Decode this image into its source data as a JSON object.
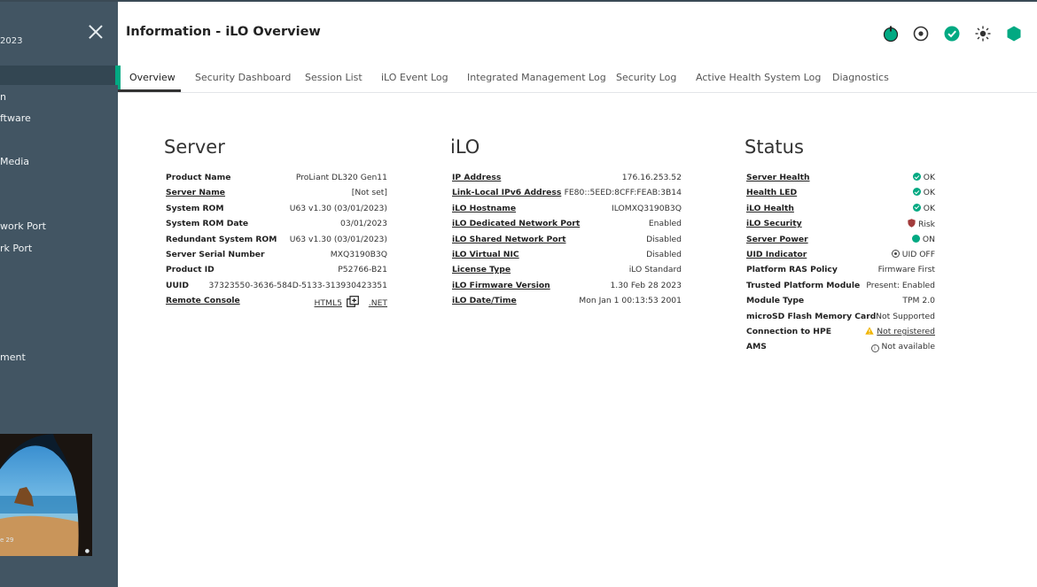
{
  "sidebar": {
    "date_fragment": "2023",
    "items": [
      {
        "label": "n",
        "top": 0
      },
      {
        "label": "ftware"
      },
      {
        "label": "Media"
      },
      {
        "label": "work Port"
      },
      {
        "label": "rk Port"
      },
      {
        "label": "ment"
      }
    ],
    "thumbnail_text": "e 29",
    "thumbnail_dot": "●"
  },
  "header": {
    "title": "Information - iLO Overview"
  },
  "colors": {
    "accent": "#01a982",
    "sidebar": "#425563",
    "risk": "#a23b3b",
    "warning": "#f0b400"
  },
  "top_icons": [
    "power-icon",
    "uid-icon",
    "health-ok-icon",
    "brightness-icon",
    "security-hexagon-icon"
  ],
  "tabs": [
    {
      "label": "Overview"
    },
    {
      "label": "Security Dashboard"
    },
    {
      "label": "Session List"
    },
    {
      "label": "iLO Event Log"
    },
    {
      "label": "Integrated Management Log"
    },
    {
      "label": "Security Log"
    },
    {
      "label": "Active Health System Log"
    },
    {
      "label": "Diagnostics"
    }
  ],
  "server": {
    "title": "Server",
    "rows": [
      {
        "label": "Product Name",
        "value": "ProLiant DL320 Gen11"
      },
      {
        "label": "Server Name",
        "value": "[Not set]"
      },
      {
        "label": "System ROM",
        "value": "U63 v1.30 (03/01/2023)"
      },
      {
        "label": "System ROM Date",
        "value": "03/01/2023"
      },
      {
        "label": "Redundant System ROM",
        "value": "U63 v1.30 (03/01/2023)"
      },
      {
        "label": "Server Serial Number",
        "value": "MXQ3190B3Q"
      },
      {
        "label": "Product ID",
        "value": "P52766-B21"
      },
      {
        "label": "UUID",
        "value": "37323550-3636-584D-5133-313930423351"
      }
    ],
    "remote_console": {
      "label": "Remote Console",
      "html5": "HTML5",
      "net": ".NET"
    }
  },
  "ilo": {
    "title": "iLO",
    "rows": [
      {
        "label": "IP Address",
        "value": "176.16.253.52"
      },
      {
        "label": "Link-Local IPv6 Address",
        "value": "FE80::5EED:8CFF:FEAB:3B14"
      },
      {
        "label": "iLO Hostname",
        "value": "ILOMXQ3190B3Q"
      },
      {
        "label": "iLO Dedicated Network Port",
        "value": "Enabled"
      },
      {
        "label": "iLO Shared Network Port",
        "value": "Disabled"
      },
      {
        "label": "iLO Virtual NIC",
        "value": "Disabled"
      },
      {
        "label": "License Type",
        "value": "iLO Standard"
      },
      {
        "label": "iLO Firmware Version",
        "value": "1.30 Feb 28 2023"
      },
      {
        "label": "iLO Date/Time",
        "value": "Mon Jan 1 00:13:53 2001"
      }
    ]
  },
  "status": {
    "title": "Status",
    "rows": [
      {
        "label": "Server Health",
        "value": "OK"
      },
      {
        "label": "Health LED",
        "value": "OK"
      },
      {
        "label": "iLO Health",
        "value": "OK"
      },
      {
        "label": "iLO Security",
        "value": "Risk"
      },
      {
        "label": "Server Power",
        "value": "ON"
      },
      {
        "label": "UID Indicator",
        "value": "UID OFF"
      },
      {
        "label": "Platform RAS Policy",
        "value": "Firmware First"
      },
      {
        "label": "Trusted Platform Module",
        "value": "Present: Enabled"
      },
      {
        "label": "Module Type",
        "value": "TPM 2.0"
      },
      {
        "label": "microSD Flash Memory Card",
        "value": "Not Supported"
      },
      {
        "label": "Connection to HPE",
        "value": "Not registered"
      },
      {
        "label": "AMS",
        "value": "Not available"
      }
    ]
  }
}
